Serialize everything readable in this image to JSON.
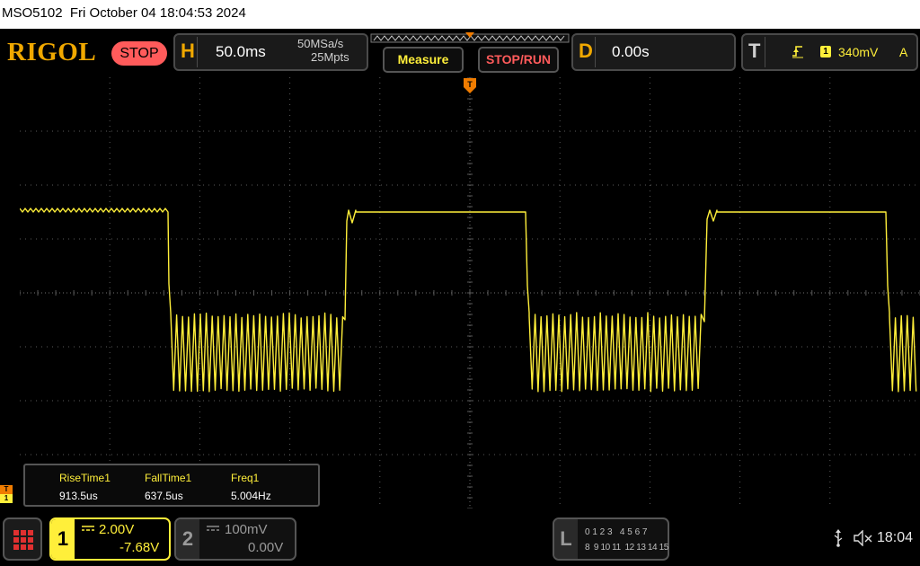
{
  "title_bar": {
    "text": "MSO5102  Fri October 04 18:04:53 2024"
  },
  "brand": {
    "logo": "RIGOL",
    "status": "STOP"
  },
  "horizontal": {
    "key": "H",
    "timebase": "50.0ms",
    "sample_rate": "50MSa/s",
    "memory_depth": "25Mpts"
  },
  "buttons": {
    "measure": "Measure",
    "stop_run": "STOP/RUN"
  },
  "delay": {
    "key": "D",
    "value": "0.00s"
  },
  "trigger": {
    "key": "T",
    "edge_icon": "rising-edge-icon",
    "source": "1",
    "level": "340mV",
    "mode": "A"
  },
  "markers": {
    "trigger_marker": "T",
    "ch1_marker": "1"
  },
  "measurements": {
    "items": [
      {
        "label": "RiseTime1",
        "value": "913.5us"
      },
      {
        "label": "FallTime1",
        "value": "637.5us"
      },
      {
        "label": "Freq1",
        "value": "5.004Hz"
      }
    ]
  },
  "channel1": {
    "number": "1",
    "coupling_icon": "dc-coupling-icon",
    "scale": "2.00V",
    "offset": "-7.68V"
  },
  "channel2": {
    "number": "2",
    "coupling_icon": "dc-coupling-icon",
    "scale": "100mV",
    "offset": "0.00V"
  },
  "logic": {
    "key": "L",
    "row1": "0 1 2 3   4 5 6 7",
    "row2": "8  9 10 11  12 13 14 15"
  },
  "status_tray": {
    "usb_icon": "usb-icon",
    "sound_icon": "muted-speaker-icon",
    "time": "18:04"
  },
  "colors": {
    "ch1": "#ffef3a",
    "accent": "#f0a800",
    "stop": "#ff5b5b",
    "grid": "#5a5a5a"
  }
}
